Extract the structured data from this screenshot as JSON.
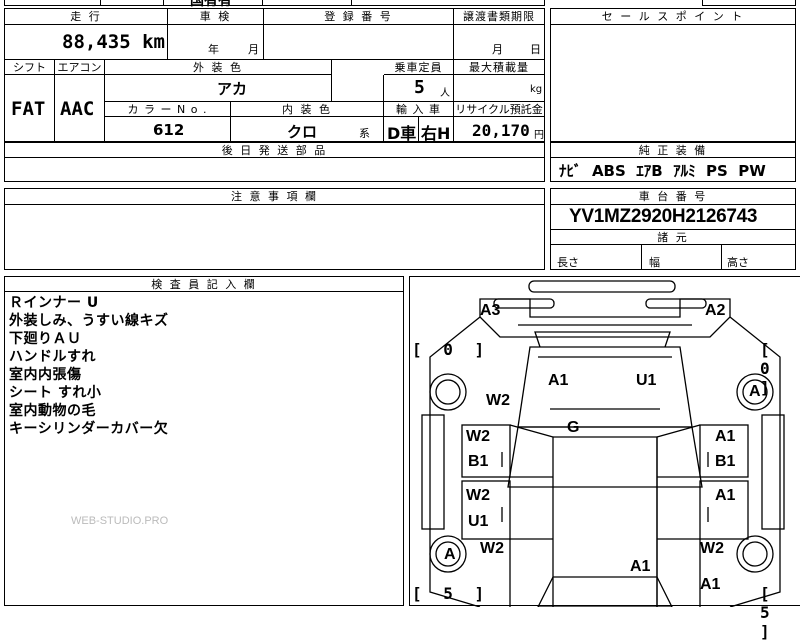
{
  "top_cut": {
    "left_text": "",
    "mid_text": "国有有"
  },
  "mileage": {
    "header": "走 行",
    "value": "88,435",
    "unit": "km"
  },
  "inspection": {
    "header": "車 検",
    "year_unit": "年",
    "month_unit": "月"
  },
  "registration": {
    "header": "登 録 番 号"
  },
  "transfer_deadline": {
    "header": "譲渡書類期限",
    "month_unit": "月",
    "day_unit": "日"
  },
  "shift": {
    "header": "シフト",
    "value": "FAT"
  },
  "aircon": {
    "header": "エアコン",
    "value": "AAC"
  },
  "exterior_color": {
    "header": "外 装 色",
    "value": "アカ"
  },
  "capacity": {
    "header": "乗車定員",
    "value": "5",
    "unit": "人"
  },
  "max_load": {
    "header": "最大積載量",
    "unit": "kg"
  },
  "color_no": {
    "header": "カ ラ ー  N o .",
    "value": "612"
  },
  "interior_color": {
    "header": "内 装 色",
    "value": "クロ",
    "suffix": "系"
  },
  "import": {
    "header": "輸 入 車",
    "type": "D車",
    "steering": "右H"
  },
  "recycle": {
    "header": "リサイクル預託金",
    "value": "20,170",
    "unit": "円"
  },
  "deferred_parts": {
    "header": "後 日 発 送 部 品"
  },
  "sales_points": {
    "header": "セ ー ル ス ポ イ ン ト"
  },
  "genuine_equipment": {
    "header": "純 正 装 備",
    "items": "ﾅﾋﾞ  ABS  ｴｱB  ｱﾙﾐ  PS  PW"
  },
  "cautions": {
    "header": "注 意 事 項 欄"
  },
  "chassis": {
    "header": "車 台 番 号",
    "value": "YV1MZ2920H2126743"
  },
  "dimensions": {
    "header": "諸 元",
    "length": "長さ",
    "width": "幅",
    "height": "高さ"
  },
  "inspector_notes": {
    "header": "検 査 員 記 入 欄",
    "lines": [
      "Ｒインナー U",
      "外装しみ、うすい線キズ",
      "下廻りＡＵ",
      "ハンドルすれ",
      "室内内張傷",
      "シート すれ小",
      "室内動物の毛",
      "キーシリンダーカバー欠"
    ],
    "watermark": "WEB-STUDIO.PRO"
  },
  "diagram": {
    "marks": {
      "a3": "A3",
      "a2": "A2",
      "bracket_left_top": "[ 0 ]",
      "bracket_right_top": "[ 0 ]",
      "hood_left": "A1",
      "hood_right": "U1",
      "w2_left_front": "W2",
      "tire_right_front": "A",
      "windshield": "G",
      "left_front_door_1": "W2",
      "left_front_door_2": "B1",
      "right_front_door_1": "A1",
      "right_front_door_2": "B1",
      "left_rear_door_1": "W2",
      "left_rear_door_2": "U1",
      "right_rear_door_1": "A1",
      "tire_left_rear": "A",
      "w2_left_rear": "W2",
      "w2_right_rear": "W2",
      "rear_center": "A1",
      "rear_right": "A1",
      "bracket_left_bottom": "[ 5 ]",
      "bracket_right_bottom": "[ 5 ]"
    }
  }
}
